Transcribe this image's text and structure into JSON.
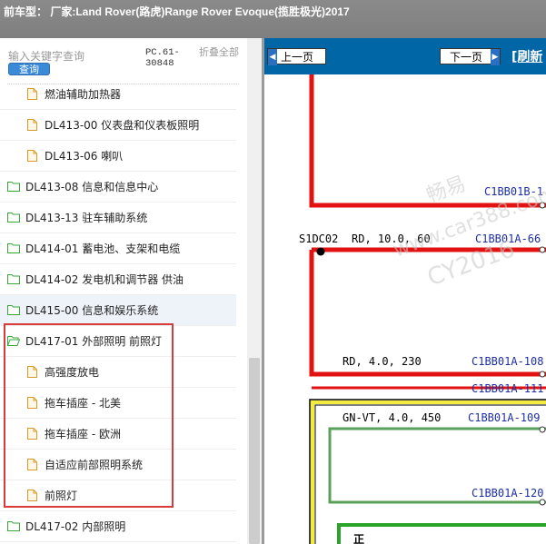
{
  "header": {
    "title": "前车型：  厂家:Land Rover(路虎)Range Rover Evoque(揽胜极光)2017"
  },
  "search": {
    "placeholder": "输入关键字查询",
    "button_label": "查询",
    "pc_code": "PC.61-30848",
    "collapse_label": "折叠全部"
  },
  "tree": {
    "items": [
      {
        "label": "燃油辅助加热器",
        "type": "file"
      },
      {
        "label": "DL413-00 仪表盘和仪表板照明",
        "type": "file"
      },
      {
        "label": "DL413-06 喇叭",
        "type": "file"
      },
      {
        "label": "DL413-08 信息和信息中心",
        "type": "folder"
      },
      {
        "label": "DL413-13 驻车辅助系统",
        "type": "folder"
      },
      {
        "label": "DL414-01 蓄电池、支架和电缆",
        "type": "folder"
      },
      {
        "label": "DL414-02 发电机和调节器 供油",
        "type": "folder"
      },
      {
        "label": "DL415-00 信息和娱乐系统",
        "type": "folder"
      },
      {
        "label": "DL417-01 外部照明 前照灯",
        "type": "folder-open"
      },
      {
        "label": "高强度放电",
        "type": "file"
      },
      {
        "label": "拖车插座 - 北美",
        "type": "file"
      },
      {
        "label": "拖车插座 - 欧洲",
        "type": "file"
      },
      {
        "label": "自适应前部照明系统",
        "type": "file"
      },
      {
        "label": "前照灯",
        "type": "file"
      },
      {
        "label": "DL417-02 内部照明",
        "type": "folder"
      }
    ]
  },
  "viewer": {
    "prev_label": "上一页",
    "next_label": "下一页",
    "refresh_label": "[刷新",
    "watermark": {
      "line1": "畅易",
      "line2": "www.car388.com",
      "line3": "CY2016"
    },
    "wires": {
      "w1_label": "C1BB01B-1",
      "splice": "S1DC02",
      "w2_spec": "RD, 10.0, 60",
      "w2_label": "C1BB01A-66",
      "w3_spec": "RD, 4.0, 230",
      "w3_label": "C1BB01A-108",
      "w4_label": "C1BB01A-111",
      "w5_spec": "GN-VT, 4.0, 450",
      "w5_label": "C1BB01A-109",
      "w6_label": "C1BB01A-120",
      "bottom_text": "正"
    },
    "colors": {
      "red_wire": "#e31212",
      "yellow_wire": "#f2ea3c",
      "green_wire": "#2aa52a",
      "label_blue": "#1d2fa6",
      "nav_blue": "#0066a6"
    }
  }
}
